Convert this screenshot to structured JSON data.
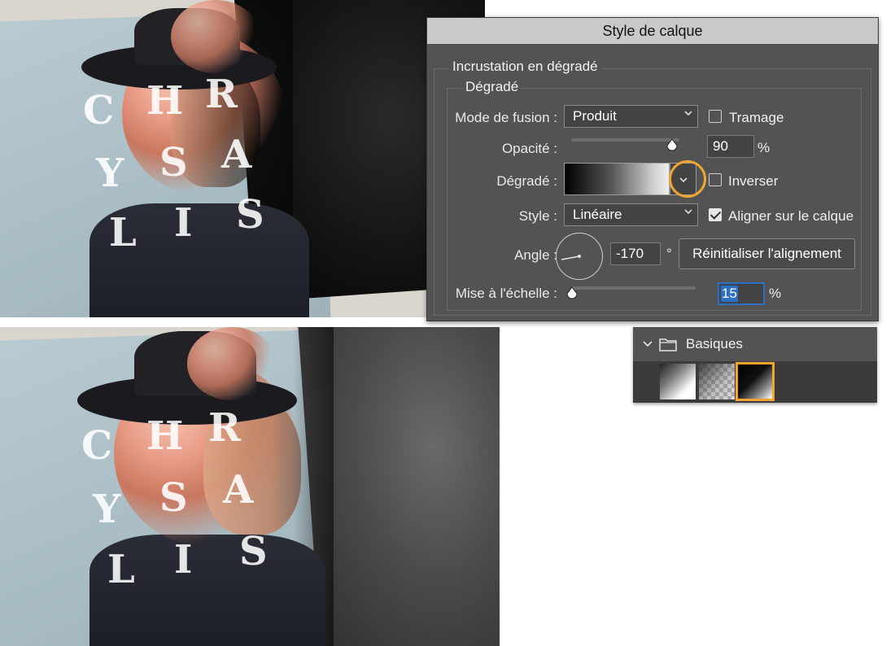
{
  "book_text": {
    "letters_top": [
      "C",
      "H",
      "R",
      "Y",
      "S",
      "A",
      "L",
      "I",
      "S"
    ],
    "letters_bottom": [
      "C",
      "H",
      "R",
      "Y",
      "S",
      "A",
      "L",
      "I",
      "S"
    ]
  },
  "dialog": {
    "title": "Style de calque",
    "section_title": "Incrustation en dégradé",
    "group_title": "Dégradé",
    "blend_mode": {
      "label": "Mode de fusion :",
      "value": "Produit"
    },
    "dither": {
      "label": "Tramage",
      "checked": false
    },
    "opacity": {
      "label": "Opacité :",
      "value": "90",
      "unit": "%",
      "level_percent": 90
    },
    "gradient": {
      "label": "Dégradé :",
      "colors": [
        "#000000",
        "#ffffff"
      ]
    },
    "reverse": {
      "label": "Inverser",
      "checked": false
    },
    "style": {
      "label": "Style :",
      "value": "Linéaire"
    },
    "align_with_layer": {
      "label": "Aligner sur le calque",
      "checked": true
    },
    "angle": {
      "label": "Angle :",
      "value": "-170",
      "unit": "°"
    },
    "reset_alignment": {
      "label": "Réinitialiser l'alignement"
    },
    "scale": {
      "label": "Mise à l'échelle :",
      "value": "15",
      "unit": "%",
      "level_percent": 15
    }
  },
  "presets": {
    "folder_name": "Basiques",
    "icons": [
      "chevron-down-icon",
      "folder-icon"
    ],
    "swatches": [
      "foreground-to-background",
      "foreground-to-transparent",
      "black-white"
    ],
    "selected_index": 2,
    "highlight_color": "#f0a630"
  },
  "colors": {
    "dialog_bg": "#535353",
    "title_bar": "#c9c9c9",
    "focus_blue": "#2d6fc4",
    "highlight": "#f0a630"
  }
}
